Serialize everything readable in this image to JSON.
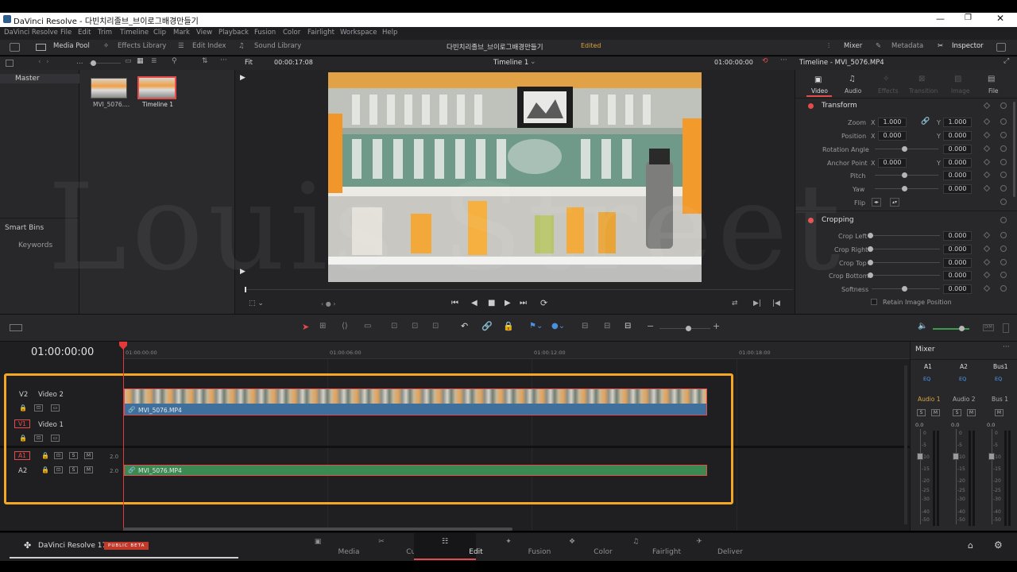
{
  "window": {
    "title": "DaVinci Resolve - 다빈치리졸브_브이로그배경만들기"
  },
  "menu": [
    "DaVinci Resolve",
    "File",
    "Edit",
    "Trim",
    "Timeline",
    "Clip",
    "Mark",
    "View",
    "Playback",
    "Fusion",
    "Color",
    "Fairlight",
    "Workspace",
    "Help"
  ],
  "toolbar": {
    "media_pool": "Media Pool",
    "effects_library": "Effects Library",
    "edit_index": "Edit Index",
    "sound_library": "Sound Library",
    "project_name": "다빈치리졸브_브이로그배경만들기",
    "status": "Edited",
    "mixer": "Mixer",
    "metadata": "Metadata",
    "inspector": "Inspector"
  },
  "subbar": {
    "fit": "Fit",
    "source_tc": "00:00:17:08",
    "timeline_name": "Timeline 1",
    "record_tc": "01:00:00:00",
    "inspector_title": "Timeline - MVI_5076.MP4"
  },
  "media_pool": {
    "master": "Master",
    "smart_bins": "Smart Bins",
    "keywords": "Keywords",
    "clips": [
      {
        "name": "MVI_5076...."
      },
      {
        "name": "Timeline 1"
      }
    ]
  },
  "inspector": {
    "tabs": [
      "Video",
      "Audio",
      "Effects",
      "Transition",
      "Image",
      "File"
    ],
    "active_tab": "Video",
    "transform": {
      "title": "Transform",
      "zoom_label": "Zoom",
      "zoom_x": "1.000",
      "zoom_y": "1.000",
      "position_label": "Position",
      "pos_x": "0.000",
      "pos_y": "0.000",
      "rotation_label": "Rotation Angle",
      "rotation": "0.000",
      "anchor_label": "Anchor Point",
      "anchor_x": "0.000",
      "anchor_y": "0.000",
      "pitch_label": "Pitch",
      "pitch": "0.000",
      "yaw_label": "Yaw",
      "yaw": "0.000",
      "flip_label": "Flip",
      "x": "X",
      "y": "Y"
    },
    "cropping": {
      "title": "Cropping",
      "crop_left_label": "Crop Left",
      "crop_left": "0.000",
      "crop_right_label": "Crop Right",
      "crop_right": "0.000",
      "crop_top_label": "Crop Top",
      "crop_top": "0.000",
      "crop_bottom_label": "Crop Bottom",
      "crop_bottom": "0.000",
      "softness_label": "Softness",
      "softness": "0.000",
      "retain_label": "Retain Image Position"
    }
  },
  "timeline": {
    "timecode": "01:00:00:00",
    "ruler": [
      "01:00:00:00",
      "01:00:06:00",
      "01:00:12:00",
      "01:00:18:00"
    ],
    "tracks": {
      "v2_id": "V2",
      "v2_name": "Video 2",
      "v1_id": "V1",
      "v1_name": "Video 1",
      "a1_id": "A1",
      "a2_id": "A2",
      "a1_ch": "2.0",
      "a2_ch": "2.0",
      "s": "S",
      "m": "M"
    },
    "video_clip": "MVI_5076.MP4",
    "audio_clip": "MVI_5076.MP4"
  },
  "mixer": {
    "title": "Mixer",
    "channels": [
      "A1",
      "A2",
      "Bus1"
    ],
    "eq": "EQ",
    "names": [
      "Audio 1",
      "Audio 2",
      "Bus 1"
    ],
    "level": "0.0",
    "scale": [
      "0",
      "-5",
      "-10",
      "-15",
      "-20",
      "-25",
      "-30",
      "-40",
      "-50"
    ]
  },
  "pages": {
    "app_name": "DaVinci Resolve 17",
    "beta": "PUBLIC BETA",
    "items": [
      "Media",
      "Cut",
      "Edit",
      "Fusion",
      "Color",
      "Fairlight",
      "Deliver"
    ],
    "active": "Edit"
  },
  "watermark": "Louis Street",
  "colors": {
    "accent": "#e64b4b",
    "highlight_box": "#f5a623",
    "video_clip": "#3f6f9c",
    "audio_clip": "#3c8a52",
    "playhead": "#e23a3a"
  }
}
